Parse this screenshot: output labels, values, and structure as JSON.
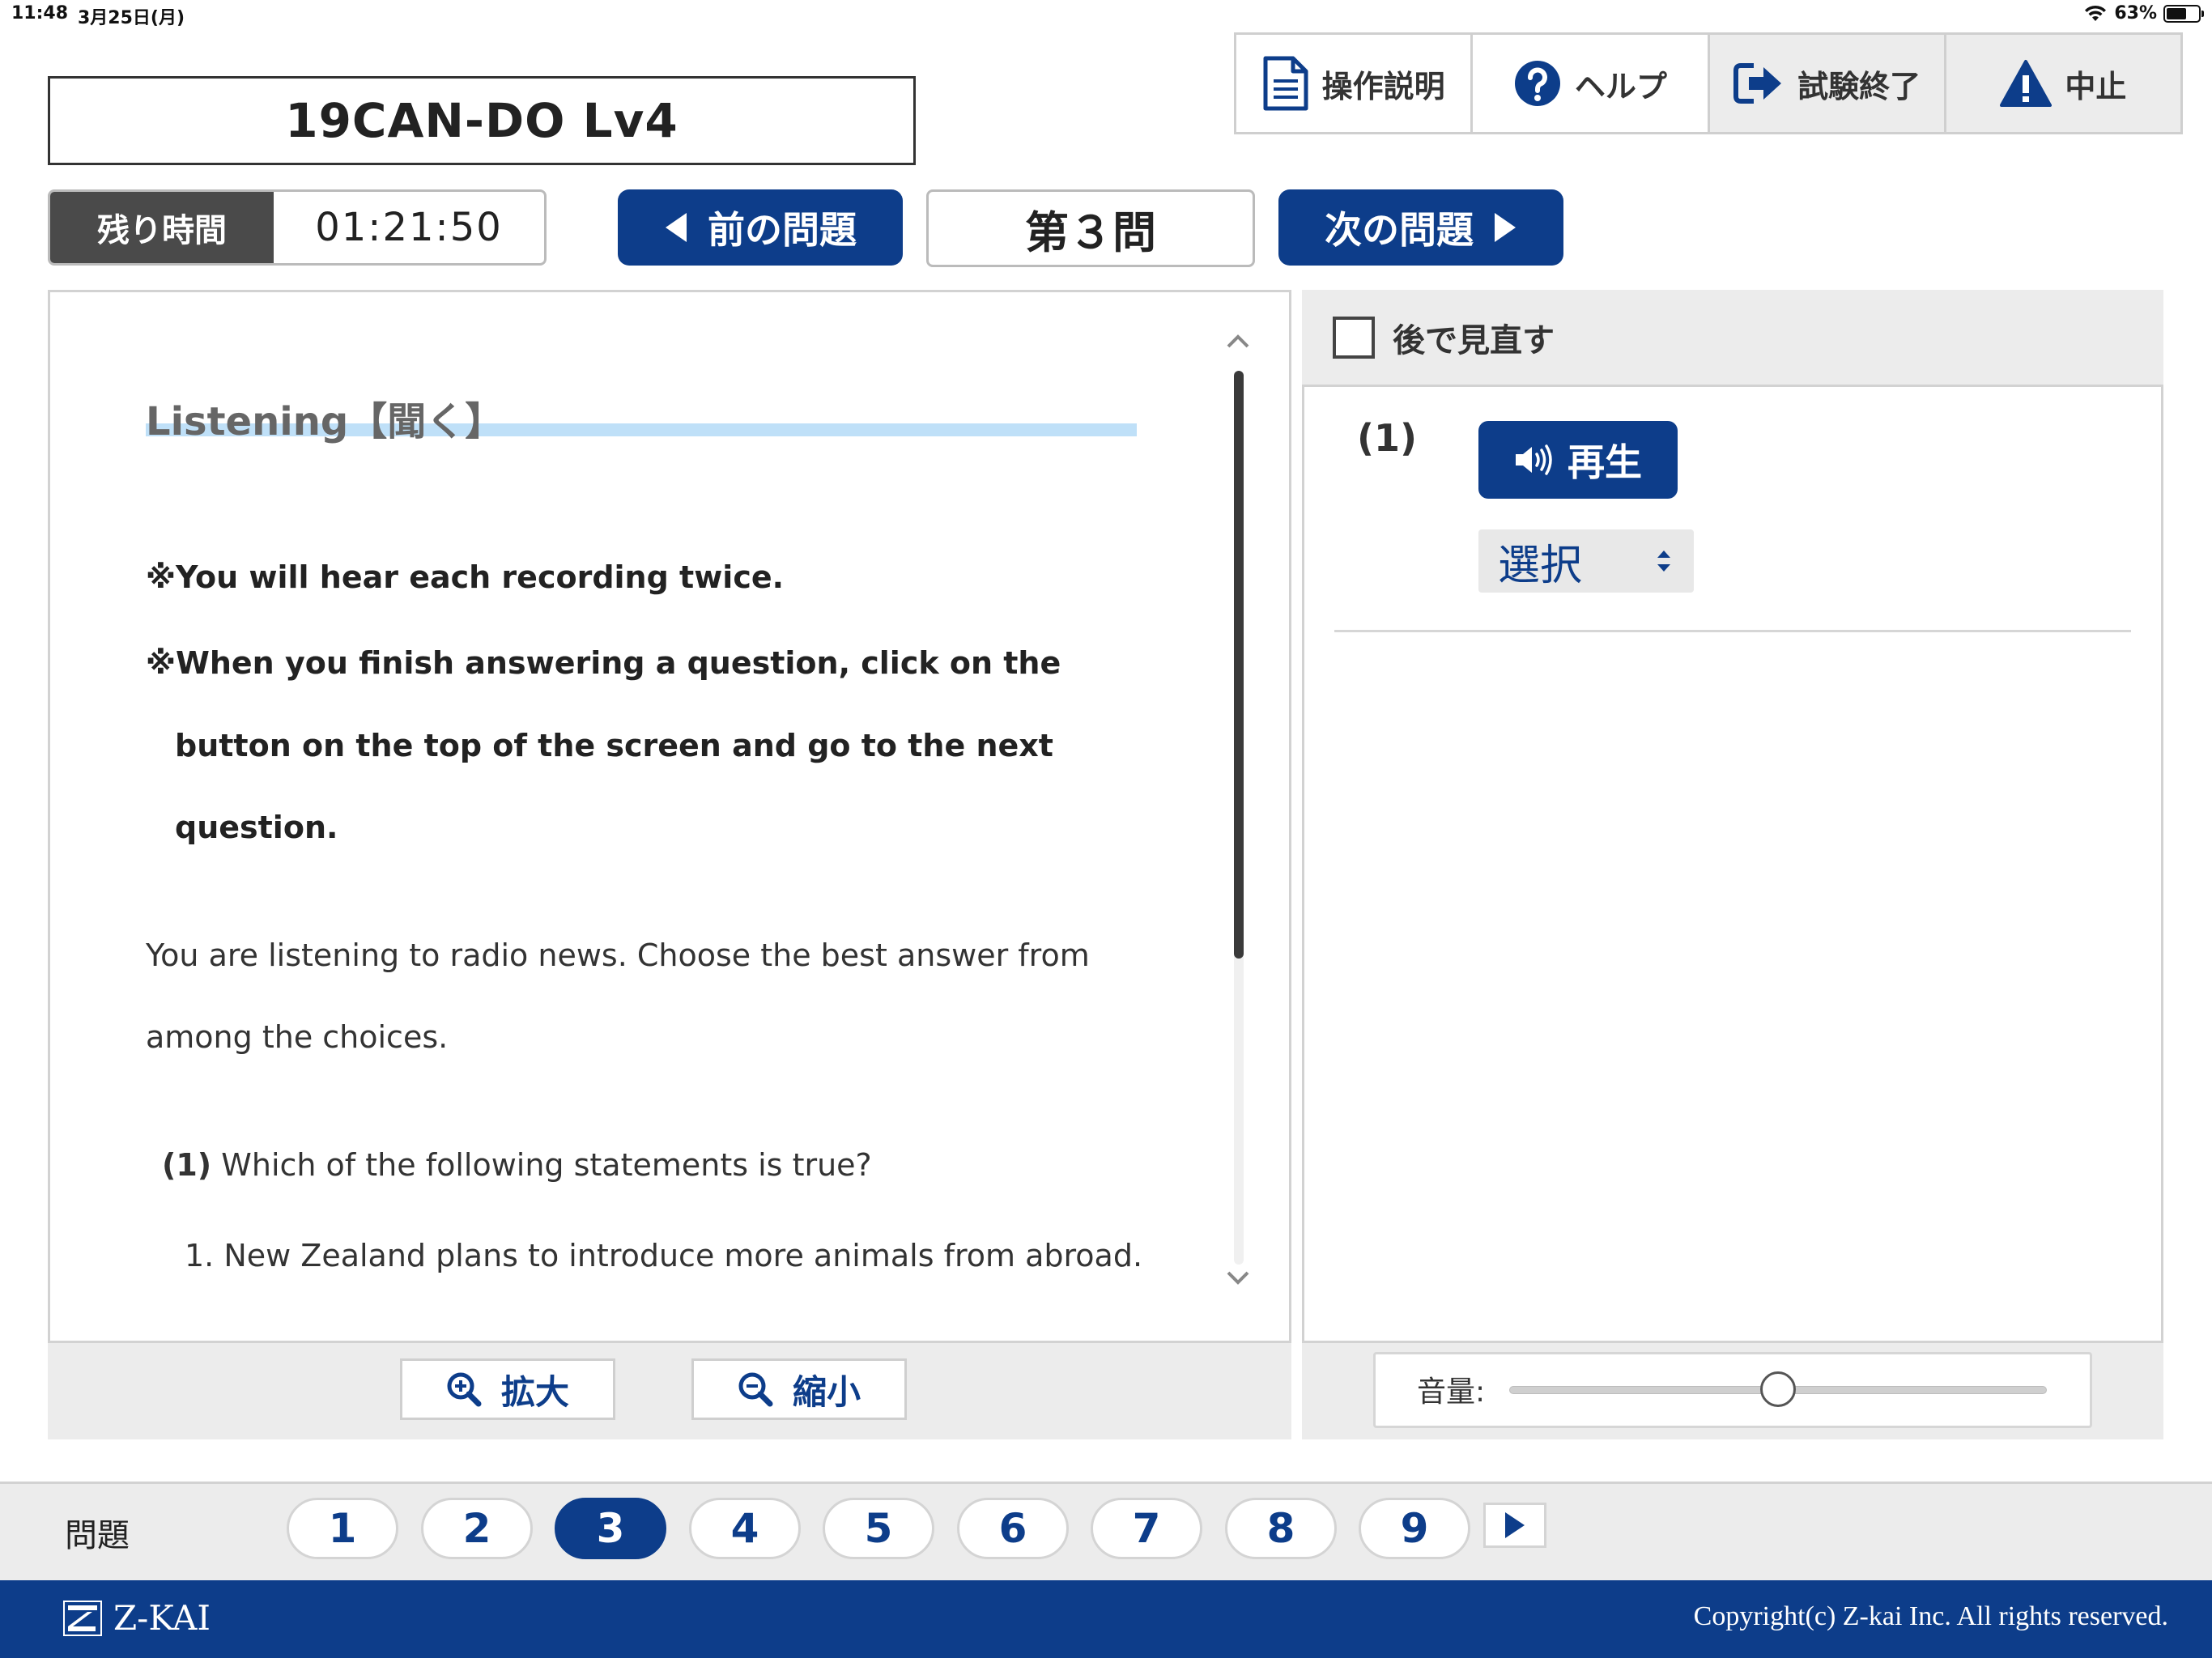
{
  "status_bar": {
    "time": "11:48",
    "date": "3月25日(月)",
    "battery_text": "63%",
    "battery_level": 0.63
  },
  "exam": {
    "title": "19CAN-DO Lv4"
  },
  "toolbar": {
    "manual": {
      "label": "操作説明",
      "icon": "document-icon"
    },
    "help": {
      "label": "ヘルプ",
      "icon": "question-circle-icon"
    },
    "finish": {
      "label": "試験終了",
      "icon": "exit-icon"
    },
    "abort": {
      "label": "中止",
      "icon": "warning-icon"
    }
  },
  "timer": {
    "label": "残り時間",
    "value": "01:21:50"
  },
  "nav": {
    "prev_label": "前の問題",
    "current": "第３問",
    "next_label": "次の問題"
  },
  "content": {
    "section_title": "Listening【聞く】",
    "instruction_1": "※You will hear each recording twice.",
    "instruction_2_line1": "※When you finish answering a question, click on the",
    "instruction_2_line2": "button on the top of the screen and go to the next",
    "instruction_2_line3": "question.",
    "intro_line1": "You are listening to radio news. Choose the best answer from",
    "intro_line2": "among the choices.",
    "question_number": "(1)",
    "question_text": "Which of the following statements is true?",
    "choice_1": "1. New Zealand plans to introduce more animals from abroad."
  },
  "zoom": {
    "in_label": "拡大",
    "out_label": "縮小"
  },
  "answer_panel": {
    "review_label": "後で見直す",
    "review_checked": false,
    "question_label": "(1)",
    "play_label": "再生",
    "select_value": "選択",
    "volume_label": "音量:",
    "volume_level": 0.5
  },
  "question_nav": {
    "label": "問題",
    "numbers": [
      "1",
      "2",
      "3",
      "4",
      "5",
      "6",
      "7",
      "8",
      "9"
    ],
    "current_index": 2
  },
  "footer": {
    "logo_text": "Z-KAI",
    "copyright": "Copyright(c) Z-kai Inc. All rights reserved."
  },
  "colors": {
    "brand_navy": "#0d3d8a",
    "timer_dark": "#4a4a4a",
    "highlight_underline": "#bfe0f8"
  }
}
